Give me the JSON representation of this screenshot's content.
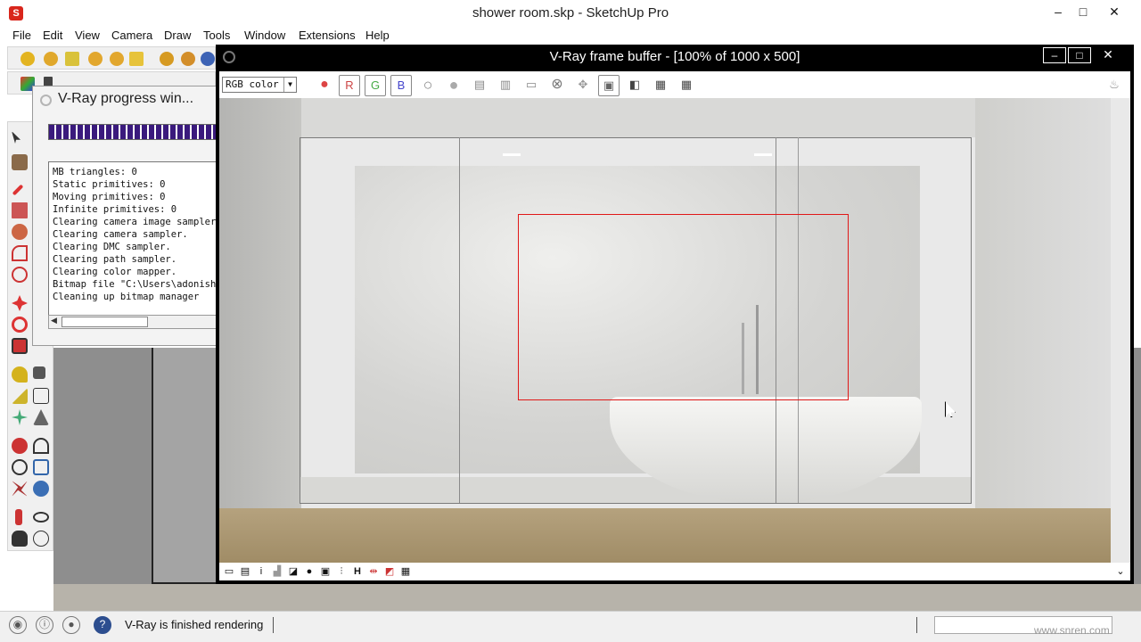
{
  "app": {
    "title": "shower room.skp - SketchUp Pro",
    "window_controls": [
      "–",
      "□",
      "✕"
    ]
  },
  "menubar": {
    "items": [
      "File",
      "Edit",
      "View",
      "Camera",
      "Draw",
      "Tools",
      "Window",
      "Extensions",
      "Help"
    ]
  },
  "progress_window": {
    "title": "V-Ray progress win...",
    "log": [
      "MB triangles: 0",
      "Static primitives: 0",
      "Moving primitives: 0",
      "Infinite primitives: 0",
      "Clearing camera image sampler.",
      "Clearing camera sampler.",
      "Clearing DMC sampler.",
      "Clearing path sampler.",
      "Clearing color mapper.",
      "Bitmap file \"C:\\Users\\adonishar",
      "Cleaning up bitmap manager"
    ]
  },
  "frame_buffer": {
    "title": "V-Ray frame buffer - [100% of 1000 x 500]",
    "channel_select": "RGB color",
    "channel_buttons": [
      "R",
      "G",
      "B"
    ],
    "controls": [
      "–",
      "□",
      "✕"
    ]
  },
  "statusbar": {
    "text": "V-Ray is finished rendering",
    "help_icon": "?"
  },
  "watermark": "www.snren.com",
  "colors": {
    "accent_progress": "#3a1a7d",
    "region_red": "#e01818",
    "vfb_black": "#000000"
  }
}
